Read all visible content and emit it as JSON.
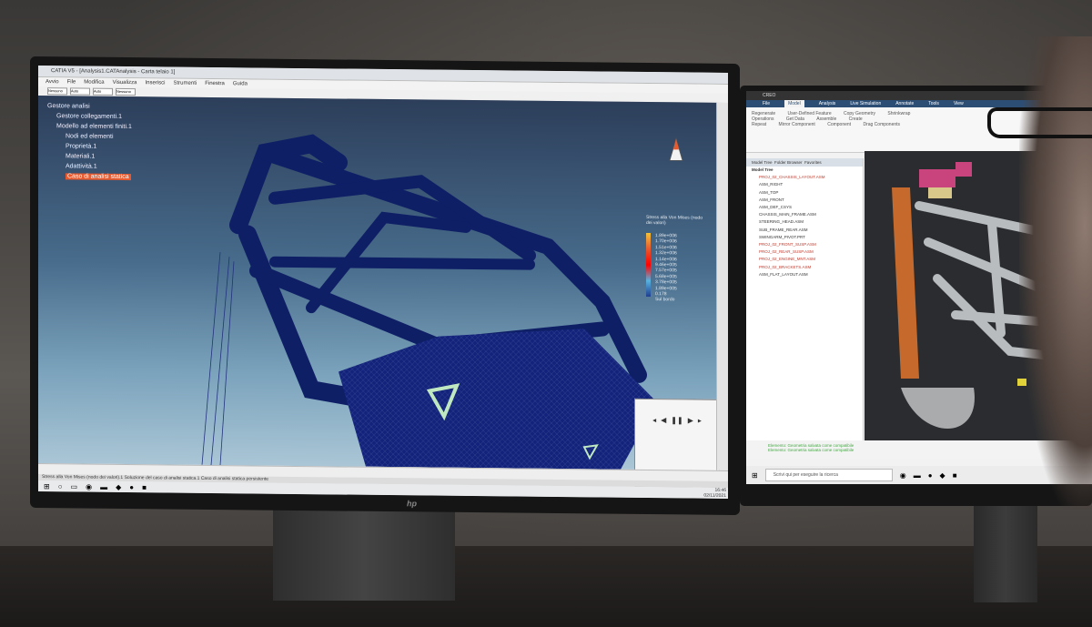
{
  "left_monitor": {
    "brand": "hp",
    "window_title": "CATIA V5 - [Analysis1.CATAnalysis - Carta telaio 1]",
    "menu": [
      "Avvio",
      "File",
      "Modifica",
      "Visualizza",
      "Inserisci",
      "Strumenti",
      "Finestra",
      "Guida"
    ],
    "toolbar_fields": [
      "Nessuno",
      "Auto",
      "Auto",
      "Nessuno"
    ],
    "tree": [
      "Gestore analisi",
      "Gestore collegamenti.1",
      "Modello ad elementi finiti.1",
      "Nodi ed elementi",
      "Proprietà.1",
      "Materiali.1",
      "Adattività.1",
      "Caso di analisi statica"
    ],
    "legend": {
      "title": "Stress alla Von Mises (nodo dei valori)",
      "values": [
        "1.89e+006",
        "1.70e+006",
        "1.51e+006",
        "1.32e+006",
        "1.14e+006",
        "9.46e+005",
        "7.57e+005",
        "5.68e+005",
        "3.78e+005",
        "1.89e+005",
        "0.178"
      ],
      "footer": "Sul bordo"
    },
    "status_text": "Stress alla Von Mises (nodo dei valori).1 Soluzione del caso di analisi statica.1 Caso di analisi statica persistente",
    "clock": {
      "time": "16:46",
      "date": "02/11/2021"
    }
  },
  "right_monitor": {
    "window_title": "CREO",
    "tabs": [
      "File",
      "Model",
      "Analysis",
      "Live Simulation",
      "Annotate",
      "Tools",
      "View"
    ],
    "ribbon_items": [
      "Regenerate",
      "User-Defined Feature",
      "Copy Geometry",
      "Shrinkwrap",
      "Operations",
      "Get Data",
      "Assemble",
      "Create",
      "Repeat",
      "Mirror Component",
      "Component",
      "Drag Components"
    ],
    "panel_tabs": [
      "Model Tree",
      "Folder Browser",
      "Favorites"
    ],
    "model_tree_title": "Model Tree",
    "model_tree": [
      {
        "label": "PROJ_02_CHASSIS_LAYOUT.ASM",
        "red": true
      },
      {
        "label": "ASM_RIGHT",
        "red": false
      },
      {
        "label": "ASM_TOP",
        "red": false
      },
      {
        "label": "ASM_FRONT",
        "red": false
      },
      {
        "label": "ASM_DEF_CSYS",
        "red": false
      },
      {
        "label": "CHASSIS_MAIN_FRAME.ASM",
        "red": false
      },
      {
        "label": "STEERING_HEAD.ASM",
        "red": false
      },
      {
        "label": "SUB_FRAME_REAR.ASM",
        "red": false
      },
      {
        "label": "SWINGARM_PIVOT.PRT",
        "red": false
      },
      {
        "label": "PROJ_02_FRONT_SUSP.ASM",
        "red": true
      },
      {
        "label": "PROJ_02_REAR_SUSP.ASM",
        "red": true
      },
      {
        "label": "PROJ_02_ENGINE_MNT.ASM",
        "red": true
      },
      {
        "label": "PROJ_02_BRACKETS.ASM",
        "red": true
      },
      {
        "label": "ASM_FLAT_LAYOUT.ASM",
        "red": false
      }
    ],
    "status_lines": [
      "Elemento: Geometria salvata come compatibile",
      "Elemento: Geometria salvata come compatibile"
    ],
    "search_placeholder": "Scrivi qui per eseguire la ricerca"
  }
}
